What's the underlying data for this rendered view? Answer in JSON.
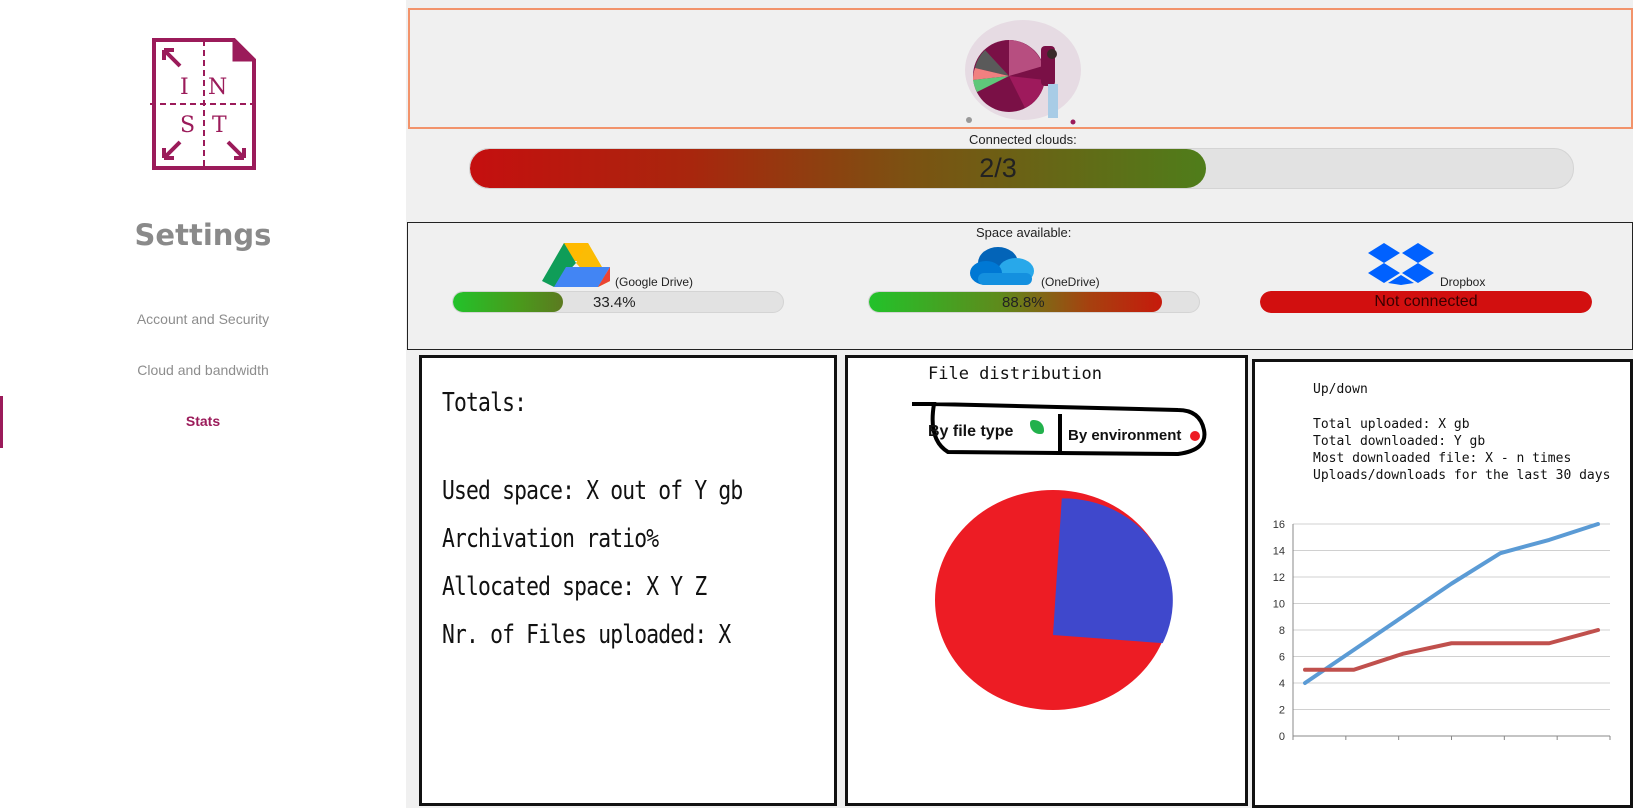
{
  "sidebar": {
    "title": "Settings",
    "items": [
      {
        "label": "Account and Security",
        "active": false
      },
      {
        "label": "Cloud and bandwidth",
        "active": false
      },
      {
        "label": "Stats",
        "active": true
      }
    ],
    "logo_text": [
      "IN",
      "ST"
    ],
    "accent": "#9b1b5a"
  },
  "connected": {
    "label": "Connected clouds:",
    "value_text": "2/3",
    "fraction": 0.667
  },
  "space": {
    "label": "Space available:",
    "clouds": [
      {
        "name": "(Google Drive)",
        "icon": "google-drive-icon",
        "value_text": "33.4%",
        "fraction": 0.334
      },
      {
        "name": "(OneDrive)",
        "icon": "onedrive-icon",
        "value_text": "88.8%",
        "fraction": 0.888
      },
      {
        "name": "Dropbox",
        "icon": "dropbox-icon",
        "value_text": "Not connected",
        "fraction": 1.0
      }
    ]
  },
  "totals": {
    "heading": "Totals:",
    "lines": [
      "Used space: X out of Y gb",
      "Archivation ratio%",
      "Allocated space: X Y Z",
      "Nr. of Files uploaded: X"
    ]
  },
  "distribution": {
    "title": "File distribution",
    "tabs": [
      "By file type",
      "By environment"
    ],
    "slice_fraction": 0.25,
    "colors": {
      "main": "#ed1c24",
      "slice": "#3f48cc"
    }
  },
  "updown": {
    "title": "Up/down",
    "lines": [
      "Total uploaded: X gb",
      "Total downloaded: Y gb",
      "Most downloaded file: X - n times",
      "Uploads/downloads for the last 30 days"
    ]
  },
  "chart_data": {
    "type": "line",
    "title": "",
    "xlabel": "",
    "ylabel": "",
    "x": [
      1,
      2,
      3,
      4,
      5,
      6,
      7
    ],
    "ylim": [
      0,
      16
    ],
    "yticks": [
      "0",
      "2",
      "4",
      "6",
      "8",
      "10",
      "12",
      "14",
      "16"
    ],
    "grid": true,
    "series": [
      {
        "color": "#5b9bd5",
        "values": [
          4,
          6.5,
          9,
          11.5,
          13.8,
          14.8,
          16
        ]
      },
      {
        "color": "#c0504d",
        "values": [
          5,
          5,
          6.2,
          7,
          7,
          7,
          8
        ]
      }
    ]
  }
}
